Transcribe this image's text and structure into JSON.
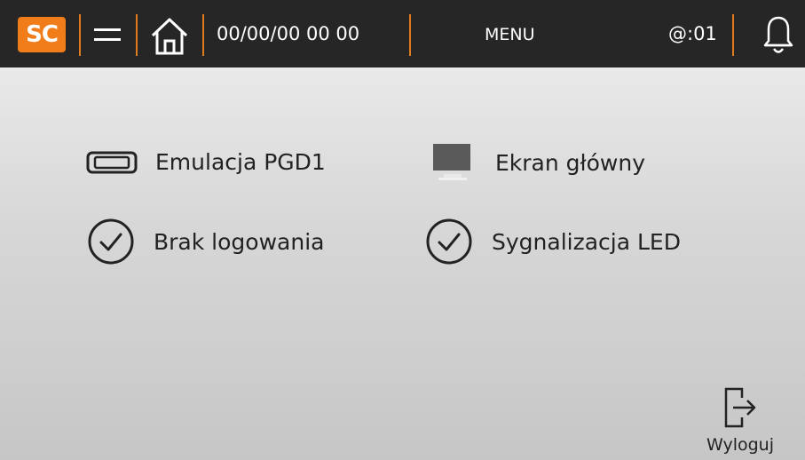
{
  "header": {
    "logo_text": "SC",
    "datetime": "00/00/00 00 00",
    "menu_label": "MENU",
    "user_indicator": "@:01",
    "icons": [
      "menu-icon",
      "home-icon",
      "bell-icon"
    ],
    "accent_color": "#f07d1a",
    "bar_color": "#262626"
  },
  "main": {
    "items": [
      {
        "label": "Emulacja PGD1",
        "icon": "display-device-icon"
      },
      {
        "label": "Ekran główny",
        "icon": "monitor-icon"
      },
      {
        "label": "Brak logowania",
        "icon": "check-circle-icon"
      },
      {
        "label": "Sygnalizacja LED",
        "icon": "check-circle-icon"
      }
    ]
  },
  "footer": {
    "logout_label": "Wyloguj",
    "logout_icon": "logout-icon"
  }
}
